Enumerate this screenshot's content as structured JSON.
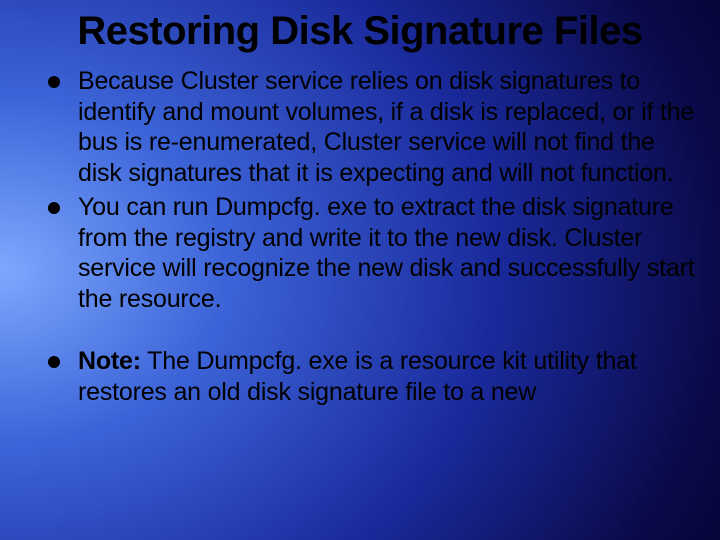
{
  "title": "Restoring Disk Signature Files",
  "bullets": [
    "Because Cluster service relies on disk signatures to identify and mount volumes, if a disk is replaced, or if the bus is re-enumerated, Cluster service will not find the disk signatures that it is expecting and will not function.",
    "You can run Dumpcfg. exe to extract the disk signature from the registry and write it to the new disk. Cluster service will recognize the new disk and successfully start the resource."
  ],
  "note_label": "Note:",
  "note_text": " The Dumpcfg. exe is a resource kit utility that restores an old disk signature file to a new"
}
